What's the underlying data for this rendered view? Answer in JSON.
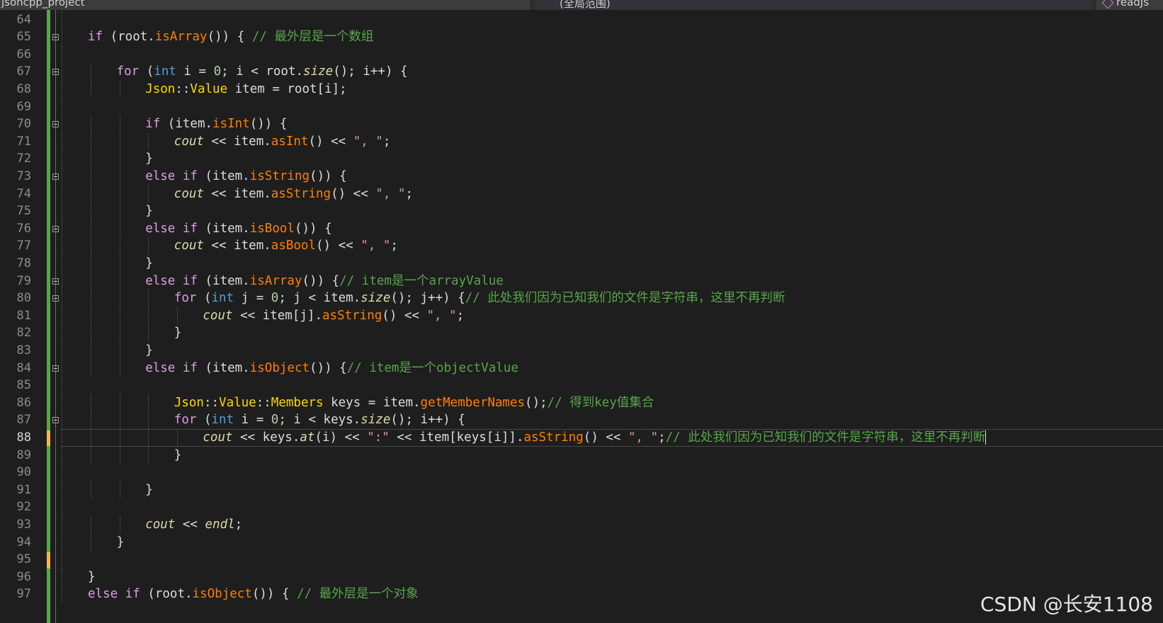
{
  "topbar": {
    "project": "jsoncpp_project",
    "scope": "(全局范围)",
    "member": "readJs"
  },
  "editor": {
    "current_line": "88",
    "lines": [
      {
        "num": "64",
        "code": ""
      },
      {
        "num": "65",
        "code": "if (root.isArray()) { // 最外层是一个数组"
      },
      {
        "num": "66",
        "code": ""
      },
      {
        "num": "67",
        "code": "for (int i = 0; i < root.size(); i++) {"
      },
      {
        "num": "68",
        "code": "Json::Value item = root[i];"
      },
      {
        "num": "69",
        "code": ""
      },
      {
        "num": "70",
        "code": "if (item.isInt()) {"
      },
      {
        "num": "71",
        "code": "cout << item.asInt() << \", \";"
      },
      {
        "num": "72",
        "code": "}"
      },
      {
        "num": "73",
        "code": "else if (item.isString()) {"
      },
      {
        "num": "74",
        "code": "cout << item.asString() << \", \";"
      },
      {
        "num": "75",
        "code": "}"
      },
      {
        "num": "76",
        "code": "else if (item.isBool()) {"
      },
      {
        "num": "77",
        "code": "cout << item.asBool() << \", \";"
      },
      {
        "num": "78",
        "code": "}"
      },
      {
        "num": "79",
        "code": "else if (item.isArray()) {// item是一个arrayValue"
      },
      {
        "num": "80",
        "code": "for (int j = 0; j < item.size(); j++) {// 此处我们因为已知我们的文件是字符串，这里不再判断"
      },
      {
        "num": "81",
        "code": "cout << item[j].asString() << \", \";"
      },
      {
        "num": "82",
        "code": "}"
      },
      {
        "num": "83",
        "code": "}"
      },
      {
        "num": "84",
        "code": "else if (item.isObject()) {// item是一个objectValue"
      },
      {
        "num": "85",
        "code": ""
      },
      {
        "num": "86",
        "code": "Json::Value::Members keys = item.getMemberNames();// 得到key值集合"
      },
      {
        "num": "87",
        "code": "for (int i = 0; i < keys.size(); i++) {"
      },
      {
        "num": "88",
        "code": "cout << keys.at(i) << \":\" << item[keys[i]].asString() << \", \";// 此处我们因为已知我们的文件是字符串，这里不再判断"
      },
      {
        "num": "89",
        "code": "}"
      },
      {
        "num": "90",
        "code": ""
      },
      {
        "num": "91",
        "code": "}"
      },
      {
        "num": "92",
        "code": ""
      },
      {
        "num": "93",
        "code": "cout << endl;"
      },
      {
        "num": "94",
        "code": "}"
      },
      {
        "num": "95",
        "code": ""
      },
      {
        "num": "96",
        "code": "}"
      },
      {
        "num": "97",
        "code": "else if (root.isObject()) { // 最外层是一个对象"
      }
    ]
  },
  "watermark": "CSDN @长安1108",
  "colors": {
    "background": "#1e1e1e",
    "keyword": "#d8a0df",
    "type": "#569cd6",
    "method": "#ff8000",
    "comment": "#57a64a",
    "string": "#d69d85",
    "class": "#ffd700",
    "changed": "#57a64a",
    "modified": "#efb74d"
  }
}
